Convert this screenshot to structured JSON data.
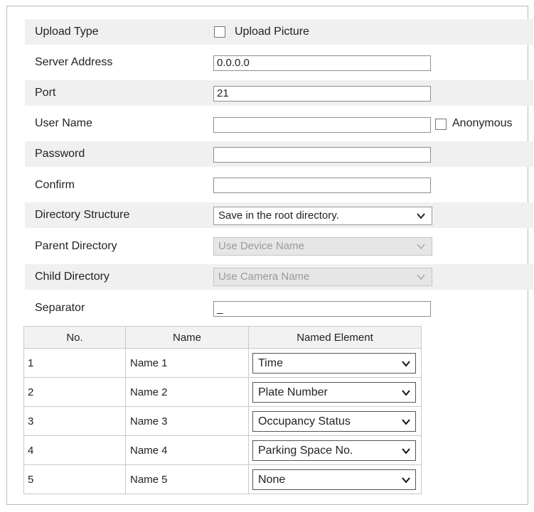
{
  "form": {
    "upload_type": {
      "label": "Upload Type",
      "checkbox_label": "Upload Picture",
      "checked": false
    },
    "server_address": {
      "label": "Server Address",
      "value": "0.0.0.0"
    },
    "port": {
      "label": "Port",
      "value": "21"
    },
    "user_name": {
      "label": "User Name",
      "value": "",
      "anonymous_label": "Anonymous",
      "anonymous_checked": false
    },
    "password": {
      "label": "Password",
      "value": ""
    },
    "confirm": {
      "label": "Confirm",
      "value": ""
    },
    "directory_structure": {
      "label": "Directory Structure",
      "value": "Save in the root directory."
    },
    "parent_directory": {
      "label": "Parent Directory",
      "value": "Use Device Name",
      "disabled": true
    },
    "child_directory": {
      "label": "Child Directory",
      "value": "Use Camera Name",
      "disabled": true
    },
    "separator": {
      "label": "Separator",
      "value": "_"
    }
  },
  "naming_table": {
    "headers": [
      "No.",
      "Name",
      "Named Element"
    ],
    "rows": [
      {
        "no": "1",
        "name": "Name 1",
        "element": "Time"
      },
      {
        "no": "2",
        "name": "Name 2",
        "element": "Plate Number"
      },
      {
        "no": "3",
        "name": "Name 3",
        "element": "Occupancy Status"
      },
      {
        "no": "4",
        "name": "Name 4",
        "element": "Parking Space No."
      },
      {
        "no": "5",
        "name": "Name 5",
        "element": "None"
      }
    ]
  },
  "icons": {
    "dropdown": "chevron-down-icon"
  }
}
